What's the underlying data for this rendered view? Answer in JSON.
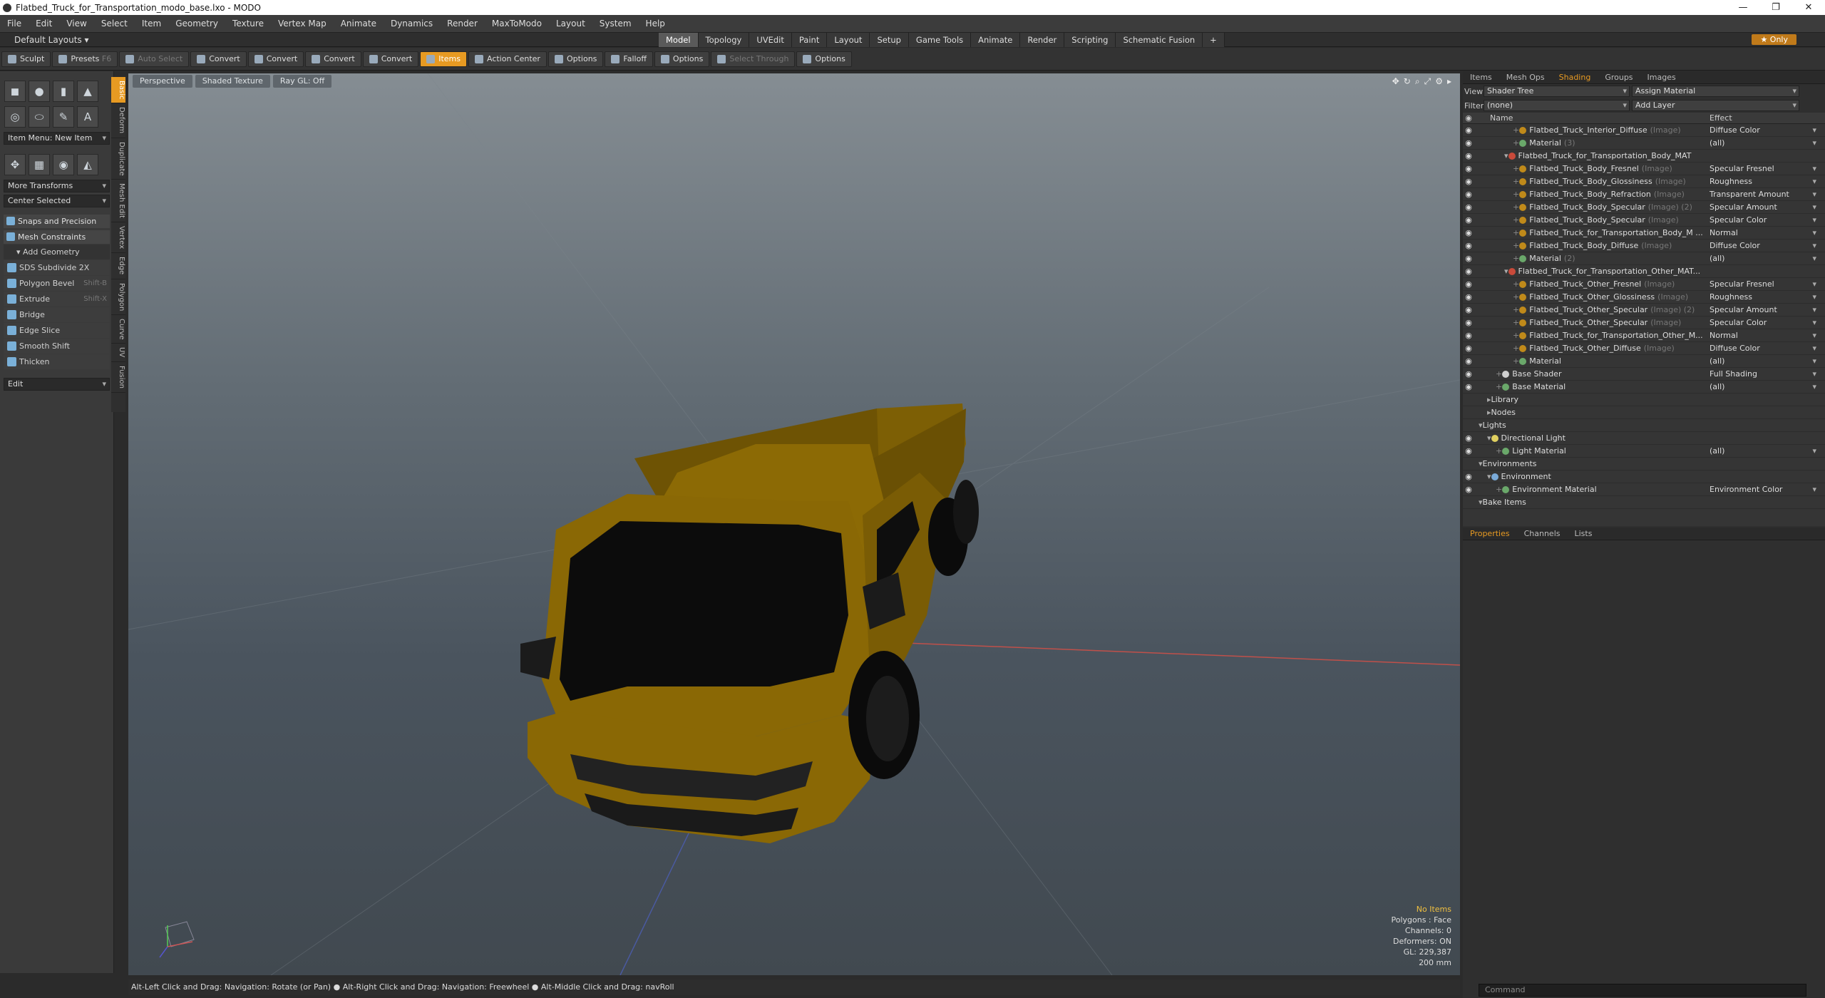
{
  "window": {
    "title": "Flatbed_Truck_for_Transportation_modo_base.lxo - MODO"
  },
  "menu": [
    "File",
    "Edit",
    "View",
    "Select",
    "Item",
    "Geometry",
    "Texture",
    "Vertex Map",
    "Animate",
    "Dynamics",
    "Render",
    "MaxToModo",
    "Layout",
    "System",
    "Help"
  ],
  "layout": {
    "label": "Default Layouts",
    "tabs": [
      "Model",
      "Topology",
      "UVEdit",
      "Paint",
      "Layout",
      "Setup",
      "Game Tools",
      "Animate",
      "Render",
      "Scripting",
      "Schematic Fusion"
    ],
    "active_tab": "Model",
    "only_label": "★ Only"
  },
  "toolbar": {
    "sculpt": "Sculpt",
    "presets": "Presets",
    "presets_key": "F6",
    "auto_select": "Auto Select",
    "convert": "Convert",
    "items": "Items",
    "action_center": "Action Center",
    "options": "Options",
    "falloff": "Falloff",
    "select_through": "Select Through"
  },
  "left_panel": {
    "item_menu": "Item Menu: New Item",
    "more_transforms": "More Transforms",
    "center_selected": "Center Selected",
    "snaps": "Snaps and Precision",
    "mesh_constraints": "Mesh Constraints",
    "add_geometry": "Add Geometry",
    "tools": [
      {
        "label": "SDS Subdivide 2X",
        "key": ""
      },
      {
        "label": "Polygon Bevel",
        "key": "Shift-B"
      },
      {
        "label": "Extrude",
        "key": "Shift-X"
      },
      {
        "label": "Bridge",
        "key": ""
      },
      {
        "label": "Edge Slice",
        "key": ""
      },
      {
        "label": "Smooth Shift",
        "key": ""
      },
      {
        "label": "Thicken",
        "key": ""
      }
    ],
    "edit": "Edit",
    "vtabs": [
      "Basic",
      "Deform",
      "Duplicate",
      "Mesh Edit",
      "Vertex",
      "Edge",
      "Polygon",
      "Curve",
      "UV",
      "Fusion"
    ]
  },
  "viewport": {
    "buttons": [
      "Perspective",
      "Shaded Texture",
      "Ray GL: Off"
    ],
    "stats": {
      "no_items": "No Items",
      "polygons": "Polygons : Face",
      "channels": "Channels: 0",
      "deformers": "Deformers: ON",
      "gl": "GL: 229,387",
      "size": "200 mm"
    }
  },
  "status": "Alt-Left Click and Drag: Navigation: Rotate (or Pan) ● Alt-Right Click and Drag: Navigation: Freewheel ● Alt-Middle Click and Drag: navRoll",
  "right_panel": {
    "tabs": [
      "Items",
      "Mesh Ops",
      "Shading",
      "Groups",
      "Images"
    ],
    "active_tab": "Shading",
    "view_label": "View",
    "view_value": "Shader Tree",
    "assign_material": "Assign Material",
    "filter_label": "Filter",
    "filter_value": "(none)",
    "add_layer": "Add Layer",
    "col_name": "Name",
    "col_effect": "Effect",
    "rows": [
      {
        "name": "Flatbed_Truck_Interior_Diffuse",
        "sub": "(Image)",
        "effect": "Diffuse Color",
        "indent": 4,
        "kind": "img"
      },
      {
        "name": "Material",
        "sub": "(3)",
        "effect": "(all)",
        "indent": 4,
        "kind": "mat"
      },
      {
        "name": "Flatbed_Truck_for_Transportation_Body_MAT",
        "sub": "",
        "effect": "",
        "indent": 3,
        "kind": "mask"
      },
      {
        "name": "Flatbed_Truck_Body_Fresnel",
        "sub": "(Image)",
        "effect": "Specular Fresnel",
        "indent": 4,
        "kind": "img"
      },
      {
        "name": "Flatbed_Truck_Body_Glossiness",
        "sub": "(Image)",
        "effect": "Roughness",
        "indent": 4,
        "kind": "img"
      },
      {
        "name": "Flatbed_Truck_Body_Refraction",
        "sub": "(Image)",
        "effect": "Transparent Amount",
        "indent": 4,
        "kind": "img"
      },
      {
        "name": "Flatbed_Truck_Body_Specular",
        "sub": "(Image) (2)",
        "effect": "Specular Amount",
        "indent": 4,
        "kind": "img"
      },
      {
        "name": "Flatbed_Truck_Body_Specular",
        "sub": "(Image)",
        "effect": "Specular Color",
        "indent": 4,
        "kind": "img"
      },
      {
        "name": "Flatbed_Truck_for_Transportation_Body_M ...",
        "sub": "",
        "effect": "Normal",
        "indent": 4,
        "kind": "img"
      },
      {
        "name": "Flatbed_Truck_Body_Diffuse",
        "sub": "(Image)",
        "effect": "Diffuse Color",
        "indent": 4,
        "kind": "img"
      },
      {
        "name": "Material",
        "sub": "(2)",
        "effect": "(all)",
        "indent": 4,
        "kind": "mat"
      },
      {
        "name": "Flatbed_Truck_for_Transportation_Other_MAT...",
        "sub": "",
        "effect": "",
        "indent": 3,
        "kind": "mask"
      },
      {
        "name": "Flatbed_Truck_Other_Fresnel",
        "sub": "(Image)",
        "effect": "Specular Fresnel",
        "indent": 4,
        "kind": "img"
      },
      {
        "name": "Flatbed_Truck_Other_Glossiness",
        "sub": "(Image)",
        "effect": "Roughness",
        "indent": 4,
        "kind": "img"
      },
      {
        "name": "Flatbed_Truck_Other_Specular",
        "sub": "(Image) (2)",
        "effect": "Specular Amount",
        "indent": 4,
        "kind": "img"
      },
      {
        "name": "Flatbed_Truck_Other_Specular",
        "sub": "(Image)",
        "effect": "Specular Color",
        "indent": 4,
        "kind": "img"
      },
      {
        "name": "Flatbed_Truck_for_Transportation_Other_M...",
        "sub": "",
        "effect": "Normal",
        "indent": 4,
        "kind": "img"
      },
      {
        "name": "Flatbed_Truck_Other_Diffuse",
        "sub": "(Image)",
        "effect": "Diffuse Color",
        "indent": 4,
        "kind": "img"
      },
      {
        "name": "Material",
        "sub": "",
        "effect": "(all)",
        "indent": 4,
        "kind": "mat"
      },
      {
        "name": "Base Shader",
        "sub": "",
        "effect": "Full Shading",
        "indent": 2,
        "kind": "shader"
      },
      {
        "name": "Base Material",
        "sub": "",
        "effect": "(all)",
        "indent": 2,
        "kind": "mat"
      },
      {
        "name": "Library",
        "sub": "",
        "effect": "",
        "indent": 1,
        "kind": "folder"
      },
      {
        "name": "Nodes",
        "sub": "",
        "effect": "",
        "indent": 1,
        "kind": "folder"
      },
      {
        "name": "Lights",
        "sub": "",
        "effect": "",
        "indent": 0,
        "kind": "group"
      },
      {
        "name": "Directional Light",
        "sub": "",
        "effect": "",
        "indent": 1,
        "kind": "light"
      },
      {
        "name": "Light Material",
        "sub": "",
        "effect": "(all)",
        "indent": 2,
        "kind": "mat"
      },
      {
        "name": "Environments",
        "sub": "",
        "effect": "",
        "indent": 0,
        "kind": "group"
      },
      {
        "name": "Environment",
        "sub": "",
        "effect": "",
        "indent": 1,
        "kind": "env"
      },
      {
        "name": "Environment Material",
        "sub": "",
        "effect": "Environment Color",
        "indent": 2,
        "kind": "mat"
      },
      {
        "name": "Bake Items",
        "sub": "",
        "effect": "",
        "indent": 0,
        "kind": "group"
      }
    ],
    "prop_tabs": [
      "Properties",
      "Channels",
      "Lists"
    ],
    "command_placeholder": "Command"
  },
  "colors": {
    "accent": "#e79a22",
    "truck": "#8c6a05"
  }
}
